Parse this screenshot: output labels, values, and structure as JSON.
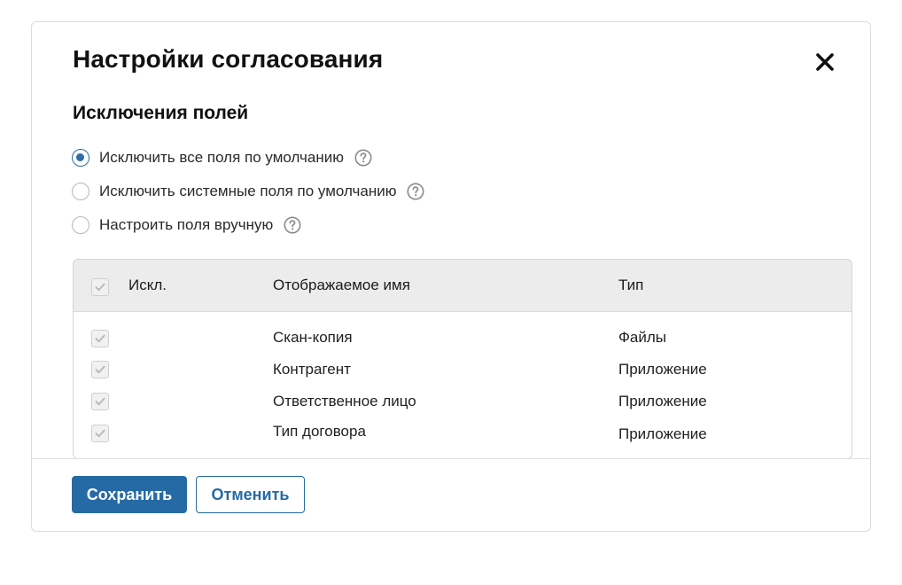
{
  "dialog": {
    "title": "Настройки согласования",
    "close_icon": "close-icon",
    "section_title": "Исключения полей"
  },
  "options": [
    {
      "label": "Исключить все поля по умолчанию",
      "checked": true
    },
    {
      "label": "Исключить системные поля по умолчанию",
      "checked": false
    },
    {
      "label": "Настроить поля вручную",
      "checked": false
    }
  ],
  "table": {
    "columns": {
      "exclude": "Искл.",
      "display_name": "Отображаемое имя",
      "type": "Тип"
    },
    "header_checked": true,
    "rows": [
      {
        "checked": true,
        "display_name": "Скан-копия",
        "type": "Файлы"
      },
      {
        "checked": true,
        "display_name": "Контрагент",
        "type": "Приложение"
      },
      {
        "checked": true,
        "display_name": "Ответственное лицо",
        "type": "Приложение"
      },
      {
        "checked": true,
        "display_name": "Тип договора",
        "type": "Приложение"
      }
    ]
  },
  "buttons": {
    "save": "Сохранить",
    "cancel": "Отменить"
  },
  "colors": {
    "accent": "#266aa5",
    "header_bg": "#ececec"
  }
}
